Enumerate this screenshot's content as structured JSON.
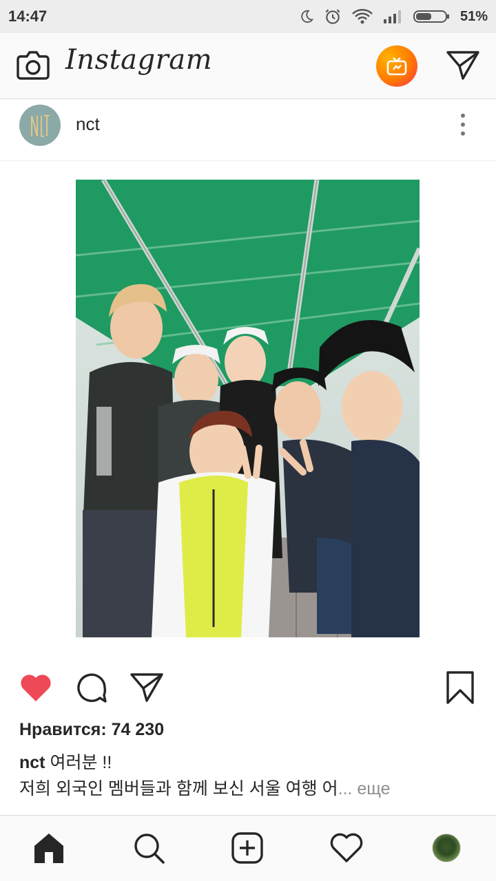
{
  "status_bar": {
    "time": "14:47",
    "battery_percent": "51%",
    "icons": [
      "moon-icon",
      "alarm-icon",
      "wifi-icon",
      "signal-icon",
      "battery-icon"
    ]
  },
  "header": {
    "logo": "Instagram",
    "icons": [
      "camera-icon",
      "igtv-icon",
      "direct-message-icon"
    ],
    "igtv_colors": [
      "#ffb300",
      "#ff7a00",
      "#ff2d55"
    ]
  },
  "post": {
    "username": "nct",
    "avatar_color": "#8aa9a7",
    "likes": "Нравится: 74 230",
    "caption_user": "nct",
    "caption_first_line": "여러분 !!",
    "caption_second_line": "저희 외국인 멤버들과 함께 보신 서울 여행 어",
    "more_label": "... еще",
    "like_color": "#ed4956",
    "icons": [
      "heart-filled-icon",
      "comment-icon",
      "share-icon",
      "bookmark-icon",
      "more-vertical-icon"
    ]
  },
  "bottom_nav": {
    "items": [
      "home-icon",
      "search-icon",
      "add-post-icon",
      "activity-heart-icon",
      "profile-avatar"
    ]
  }
}
